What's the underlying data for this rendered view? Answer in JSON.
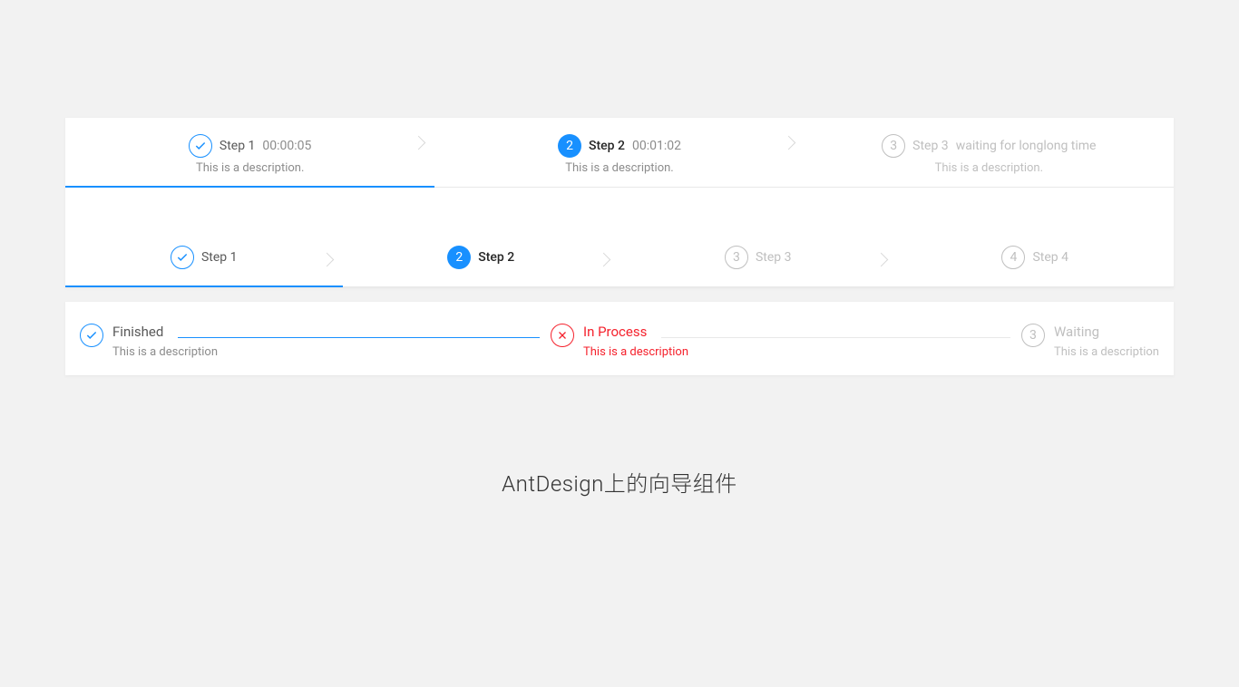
{
  "stepsA": [
    {
      "status": "finish",
      "num": "1",
      "title": "Step 1",
      "subtitle": "00:00:05",
      "desc": "This is a description."
    },
    {
      "status": "process",
      "num": "2",
      "title": "Step 2",
      "subtitle": "00:01:02",
      "desc": "This is a description."
    },
    {
      "status": "wait",
      "num": "3",
      "title": "Step 3",
      "subtitle": "waiting for longlong time",
      "desc": "This is a description."
    }
  ],
  "stepsB": [
    {
      "status": "finish",
      "num": "1",
      "title": "Step 1"
    },
    {
      "status": "process",
      "num": "2",
      "title": "Step 2"
    },
    {
      "status": "wait",
      "num": "3",
      "title": "Step 3"
    },
    {
      "status": "wait",
      "num": "4",
      "title": "Step 4"
    }
  ],
  "stepsC": [
    {
      "status": "finish",
      "num": "1",
      "title": "Finished",
      "desc": "This is a description"
    },
    {
      "status": "error",
      "num": "2",
      "title": "In Process",
      "desc": "This is a description"
    },
    {
      "status": "wait",
      "num": "3",
      "title": "Waiting",
      "desc": "This is a description"
    }
  ],
  "caption": "AntDesign上的向导组件"
}
